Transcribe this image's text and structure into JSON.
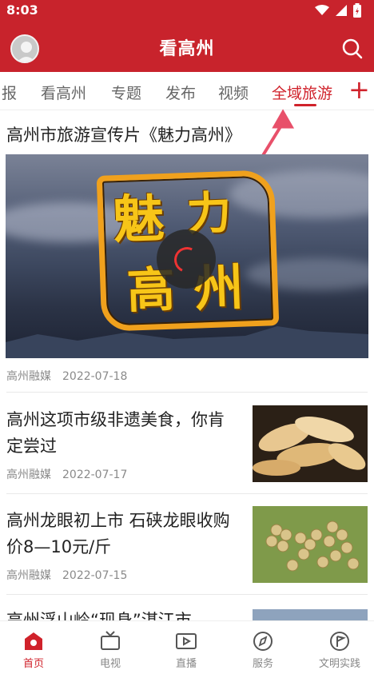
{
  "status_bar": {
    "time": "8:03"
  },
  "app_bar": {
    "title": "看高州"
  },
  "tabs": [
    {
      "label": "报"
    },
    {
      "label": "看高州"
    },
    {
      "label": "专题"
    },
    {
      "label": "发布"
    },
    {
      "label": "视频"
    },
    {
      "label": "全域旅游",
      "active": true
    }
  ],
  "tab_add_label": "+",
  "featured": {
    "title": "高州市旅游宣传片《魅力高州》",
    "logo_text": [
      "魅",
      "力",
      "高",
      "州"
    ],
    "source": "高州融媒",
    "date": "2022-07-18"
  },
  "articles": [
    {
      "title": "高州这项市级非遗美食，你肯定尝过",
      "source": "高州融媒",
      "date": "2022-07-17"
    },
    {
      "title": "高州龙眼初上市 石硖龙眼收购价8—10元/斤",
      "source": "高州融媒",
      "date": "2022-07-15"
    },
    {
      "title": "高州浮山岭“现身”湛江市"
    }
  ],
  "bottom_nav": [
    {
      "label": "首页",
      "icon": "home-icon",
      "active": true
    },
    {
      "label": "电视",
      "icon": "tv-icon"
    },
    {
      "label": "直播",
      "icon": "live-icon"
    },
    {
      "label": "服务",
      "icon": "compass-icon"
    },
    {
      "label": "文明实践",
      "icon": "flag-icon"
    }
  ],
  "colors": {
    "brand": "#c8232c",
    "accent": "#d0222b"
  }
}
